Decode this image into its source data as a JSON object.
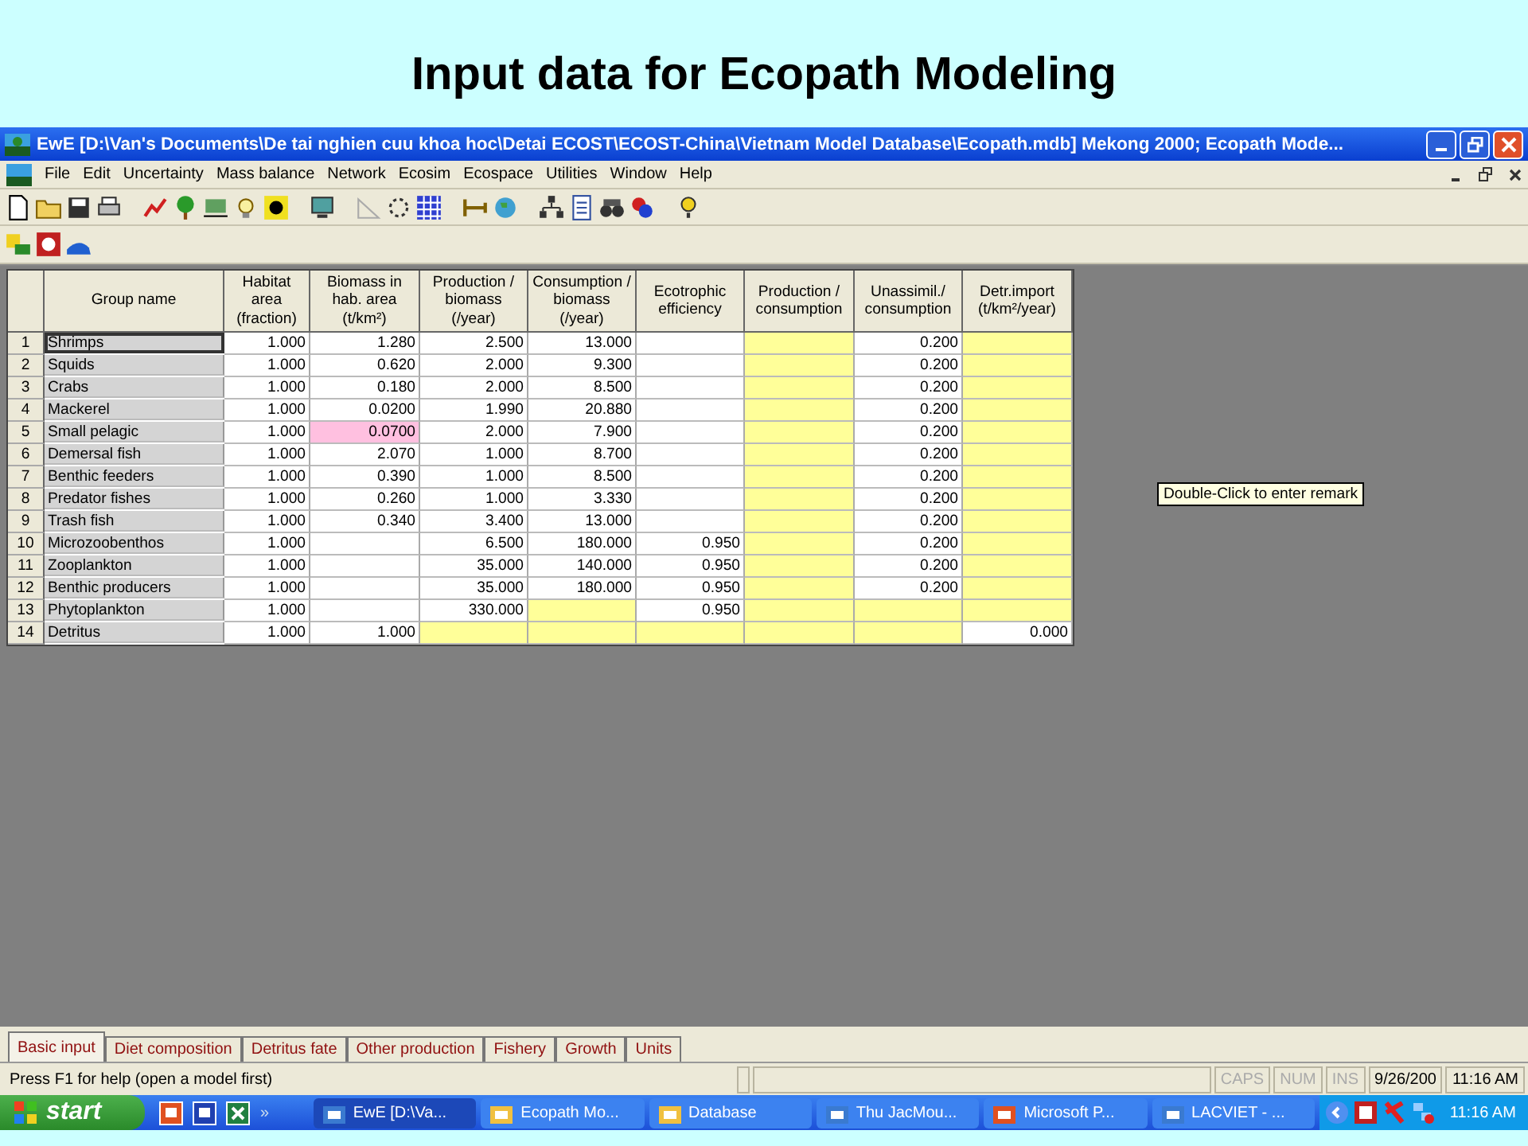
{
  "slide_title": "Input data for Ecopath Modeling",
  "window": {
    "title": "EwE [D:\\Van's Documents\\De tai nghien cuu khoa hoc\\Detai ECOST\\ECOST-China\\Vietnam Model Database\\Ecopath.mdb] Mekong 2000; Ecopath Mode..."
  },
  "menu": [
    "File",
    "Edit",
    "Uncertainty",
    "Mass balance",
    "Network",
    "Ecosim",
    "Ecospace",
    "Utilities",
    "Window",
    "Help"
  ],
  "table": {
    "columns": [
      "",
      "Group name",
      "Habitat area (fraction)",
      "Biomass in hab. area (t/km²)",
      "Production / biomass (/year)",
      "Consumption / biomass (/year)",
      "Ecotrophic efficiency",
      "Production / consumption",
      "Unassimil./ consumption",
      "Detr.import (t/km²/year)"
    ],
    "rows": [
      {
        "selected": true,
        "cells": [
          {
            "kind": "number",
            "text": "1"
          },
          {
            "kind": "name",
            "text": "Shrimps"
          },
          {
            "kind": "entry",
            "text": "1.000"
          },
          {
            "kind": "entry",
            "text": "1.280"
          },
          {
            "kind": "entry",
            "text": "2.500"
          },
          {
            "kind": "entry",
            "text": "13.000"
          },
          {
            "kind": "entry"
          },
          {
            "kind": "estimate"
          },
          {
            "kind": "entry",
            "text": "0.200"
          },
          {
            "kind": "estimate"
          }
        ]
      },
      {
        "selected": false,
        "cells": [
          {
            "kind": "number",
            "text": "2"
          },
          {
            "kind": "name",
            "text": "Squids"
          },
          {
            "kind": "entry",
            "text": "1.000"
          },
          {
            "kind": "entry",
            "text": "0.620"
          },
          {
            "kind": "entry",
            "text": "2.000"
          },
          {
            "kind": "entry",
            "text": "9.300"
          },
          {
            "kind": "entry"
          },
          {
            "kind": "estimate"
          },
          {
            "kind": "entry",
            "text": "0.200"
          },
          {
            "kind": "estimate"
          }
        ]
      },
      {
        "selected": false,
        "cells": [
          {
            "kind": "number",
            "text": "3"
          },
          {
            "kind": "name",
            "text": "Crabs"
          },
          {
            "kind": "entry",
            "text": "1.000"
          },
          {
            "kind": "entry",
            "text": "0.180"
          },
          {
            "kind": "entry",
            "text": "2.000"
          },
          {
            "kind": "entry",
            "text": "8.500"
          },
          {
            "kind": "entry"
          },
          {
            "kind": "estimate"
          },
          {
            "kind": "entry",
            "text": "0.200"
          },
          {
            "kind": "estimate"
          }
        ]
      },
      {
        "selected": false,
        "cells": [
          {
            "kind": "number",
            "text": "4"
          },
          {
            "kind": "name",
            "text": "Mackerel"
          },
          {
            "kind": "entry",
            "text": "1.000"
          },
          {
            "kind": "entry",
            "text": "0.0200"
          },
          {
            "kind": "entry",
            "text": "1.990"
          },
          {
            "kind": "entry",
            "text": "20.880"
          },
          {
            "kind": "entry"
          },
          {
            "kind": "estimate"
          },
          {
            "kind": "entry",
            "text": "0.200"
          },
          {
            "kind": "estimate"
          }
        ]
      },
      {
        "selected": false,
        "cells": [
          {
            "kind": "number",
            "text": "5"
          },
          {
            "kind": "name",
            "text": "Small pelagic"
          },
          {
            "kind": "entry",
            "text": "1.000"
          },
          {
            "kind": "flagged",
            "text": "0.0700"
          },
          {
            "kind": "entry",
            "text": "2.000"
          },
          {
            "kind": "entry",
            "text": "7.900"
          },
          {
            "kind": "entry"
          },
          {
            "kind": "estimate"
          },
          {
            "kind": "entry",
            "text": "0.200"
          },
          {
            "kind": "estimate"
          }
        ]
      },
      {
        "selected": false,
        "cells": [
          {
            "kind": "number",
            "text": "6"
          },
          {
            "kind": "name",
            "text": "Demersal fish"
          },
          {
            "kind": "entry",
            "text": "1.000"
          },
          {
            "kind": "entry",
            "text": "2.070"
          },
          {
            "kind": "entry",
            "text": "1.000"
          },
          {
            "kind": "entry",
            "text": "8.700"
          },
          {
            "kind": "entry"
          },
          {
            "kind": "estimate"
          },
          {
            "kind": "entry",
            "text": "0.200"
          },
          {
            "kind": "estimate"
          }
        ]
      },
      {
        "selected": false,
        "cells": [
          {
            "kind": "number",
            "text": "7"
          },
          {
            "kind": "name",
            "text": "Benthic feeders"
          },
          {
            "kind": "entry",
            "text": "1.000"
          },
          {
            "kind": "entry",
            "text": "0.390"
          },
          {
            "kind": "entry",
            "text": "1.000"
          },
          {
            "kind": "entry",
            "text": "8.500"
          },
          {
            "kind": "entry"
          },
          {
            "kind": "estimate"
          },
          {
            "kind": "entry",
            "text": "0.200"
          },
          {
            "kind": "estimate"
          }
        ]
      },
      {
        "selected": false,
        "cells": [
          {
            "kind": "number",
            "text": "8"
          },
          {
            "kind": "name",
            "text": "Predator fishes"
          },
          {
            "kind": "entry",
            "text": "1.000"
          },
          {
            "kind": "entry",
            "text": "0.260"
          },
          {
            "kind": "entry",
            "text": "1.000"
          },
          {
            "kind": "entry",
            "text": "3.330"
          },
          {
            "kind": "entry"
          },
          {
            "kind": "estimate"
          },
          {
            "kind": "entry",
            "text": "0.200"
          },
          {
            "kind": "estimate"
          }
        ]
      },
      {
        "selected": false,
        "cells": [
          {
            "kind": "number",
            "text": "9"
          },
          {
            "kind": "name",
            "text": "Trash fish"
          },
          {
            "kind": "entry",
            "text": "1.000"
          },
          {
            "kind": "entry",
            "text": "0.340"
          },
          {
            "kind": "entry",
            "text": "3.400"
          },
          {
            "kind": "entry",
            "text": "13.000"
          },
          {
            "kind": "entry"
          },
          {
            "kind": "estimate"
          },
          {
            "kind": "entry",
            "text": "0.200"
          },
          {
            "kind": "estimate"
          }
        ]
      },
      {
        "selected": false,
        "cells": [
          {
            "kind": "number",
            "text": "10"
          },
          {
            "kind": "name",
            "text": "Microzoobenthos"
          },
          {
            "kind": "entry",
            "text": "1.000"
          },
          {
            "kind": "entry"
          },
          {
            "kind": "entry",
            "text": "6.500"
          },
          {
            "kind": "entry",
            "text": "180.000"
          },
          {
            "kind": "entry",
            "text": "0.950"
          },
          {
            "kind": "estimate"
          },
          {
            "kind": "entry",
            "text": "0.200"
          },
          {
            "kind": "estimate"
          }
        ]
      },
      {
        "selected": false,
        "cells": [
          {
            "kind": "number",
            "text": "11"
          },
          {
            "kind": "name",
            "text": "Zooplankton"
          },
          {
            "kind": "entry",
            "text": "1.000"
          },
          {
            "kind": "entry"
          },
          {
            "kind": "entry",
            "text": "35.000"
          },
          {
            "kind": "entry",
            "text": "140.000"
          },
          {
            "kind": "entry",
            "text": "0.950"
          },
          {
            "kind": "estimate"
          },
          {
            "kind": "entry",
            "text": "0.200"
          },
          {
            "kind": "estimate"
          }
        ]
      },
      {
        "selected": false,
        "cells": [
          {
            "kind": "number",
            "text": "12"
          },
          {
            "kind": "name",
            "text": "Benthic producers"
          },
          {
            "kind": "entry",
            "text": "1.000"
          },
          {
            "kind": "entry"
          },
          {
            "kind": "entry",
            "text": "35.000"
          },
          {
            "kind": "entry",
            "text": "180.000"
          },
          {
            "kind": "entry",
            "text": "0.950"
          },
          {
            "kind": "estimate"
          },
          {
            "kind": "entry",
            "text": "0.200"
          },
          {
            "kind": "estimate"
          }
        ]
      },
      {
        "selected": false,
        "cells": [
          {
            "kind": "number",
            "text": "13"
          },
          {
            "kind": "name",
            "text": "Phytoplankton"
          },
          {
            "kind": "entry",
            "text": "1.000"
          },
          {
            "kind": "entry"
          },
          {
            "kind": "entry",
            "text": "330.000"
          },
          {
            "kind": "estimate"
          },
          {
            "kind": "entry",
            "text": "0.950"
          },
          {
            "kind": "estimate"
          },
          {
            "kind": "estimate"
          },
          {
            "kind": "estimate"
          }
        ]
      },
      {
        "selected": false,
        "cells": [
          {
            "kind": "number",
            "text": "14"
          },
          {
            "kind": "name",
            "text": "Detritus"
          },
          {
            "kind": "entry",
            "text": "1.000"
          },
          {
            "kind": "entry",
            "text": "1.000"
          },
          {
            "kind": "estimate"
          },
          {
            "kind": "estimate"
          },
          {
            "kind": "estimate"
          },
          {
            "kind": "estimate"
          },
          {
            "kind": "estimate"
          },
          {
            "kind": "entry",
            "text": "0.000"
          }
        ]
      }
    ]
  },
  "tooltip": "Double-Click to enter remark",
  "tabs": [
    {
      "label": "Basic input",
      "selected": true
    },
    {
      "label": "Diet composition",
      "selected": false
    },
    {
      "label": "Detritus fate",
      "selected": false
    },
    {
      "label": "Other production",
      "selected": false
    },
    {
      "label": "Fishery",
      "selected": false
    },
    {
      "label": "Growth",
      "selected": false
    },
    {
      "label": "Units",
      "selected": false
    }
  ],
  "status_bar": {
    "message": "Press F1 for help (open a model first)",
    "indicators": [
      {
        "label": "CAPS",
        "disabled": true
      },
      {
        "label": "NUM",
        "disabled": true
      },
      {
        "label": "INS",
        "disabled": true
      },
      {
        "label": "9/26/200",
        "disabled": false
      },
      {
        "label": "11:16 AM",
        "disabled": false
      }
    ]
  },
  "taskbar": {
    "start": "start",
    "chevron": "»",
    "tasks": [
      {
        "label": "EwE [D:\\Va...",
        "selected": true
      },
      {
        "label": "Ecopath Mo...",
        "selected": false
      },
      {
        "label": "Database",
        "selected": false
      },
      {
        "label": "Thu JacMou...",
        "selected": false
      },
      {
        "label": "Microsoft P...",
        "selected": false
      },
      {
        "label": "LACVIET - ...",
        "selected": false
      }
    ],
    "clock": "11:16 AM"
  }
}
